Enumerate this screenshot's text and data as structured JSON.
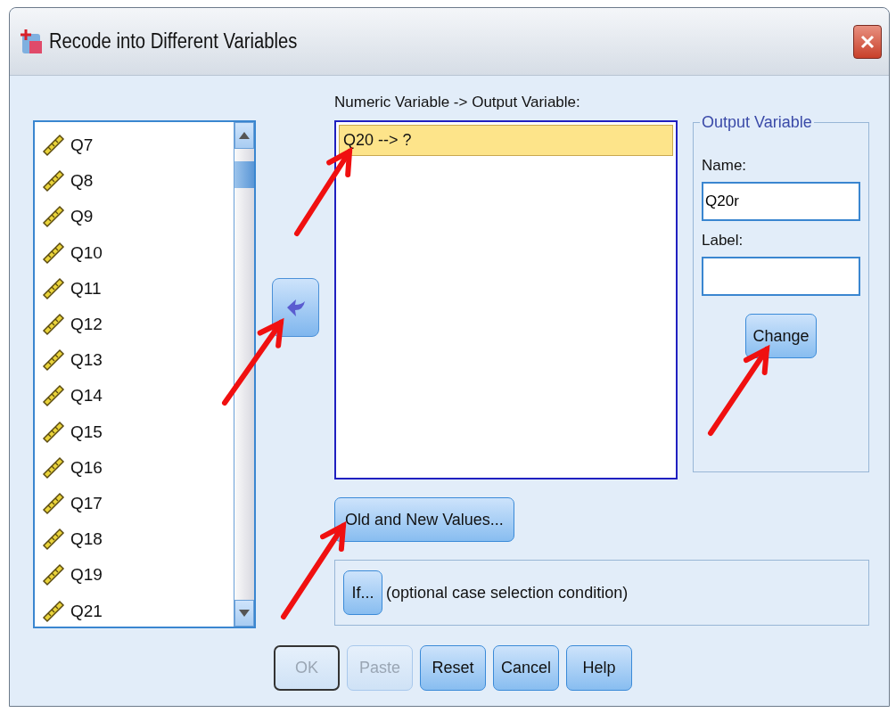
{
  "window": {
    "title": "Recode into Different Variables"
  },
  "source_variables": [
    "Q7",
    "Q8",
    "Q9",
    "Q10",
    "Q11",
    "Q12",
    "Q13",
    "Q14",
    "Q15",
    "Q16",
    "Q17",
    "Q18",
    "Q19",
    "Q21"
  ],
  "mapping": {
    "label": "Numeric Variable -> Output Variable:",
    "items": [
      {
        "text": "Q20 --> ?",
        "selected": true
      }
    ]
  },
  "output_variable": {
    "title": "Output Variable",
    "name_label": "Name:",
    "name_value": "Q20r",
    "label_label": "Label:",
    "change_button": "Change"
  },
  "old_new_button": "Old and New Values...",
  "condition": {
    "button": "If...",
    "text": "(optional case selection condition)"
  },
  "buttons": [
    {
      "label": "OK",
      "disabled": true,
      "default": true
    },
    {
      "label": "Paste",
      "disabled": true,
      "default": false
    },
    {
      "label": "Reset",
      "disabled": false,
      "default": false
    },
    {
      "label": "Cancel",
      "disabled": false,
      "default": false
    },
    {
      "label": "Help",
      "disabled": false,
      "default": false
    }
  ]
}
